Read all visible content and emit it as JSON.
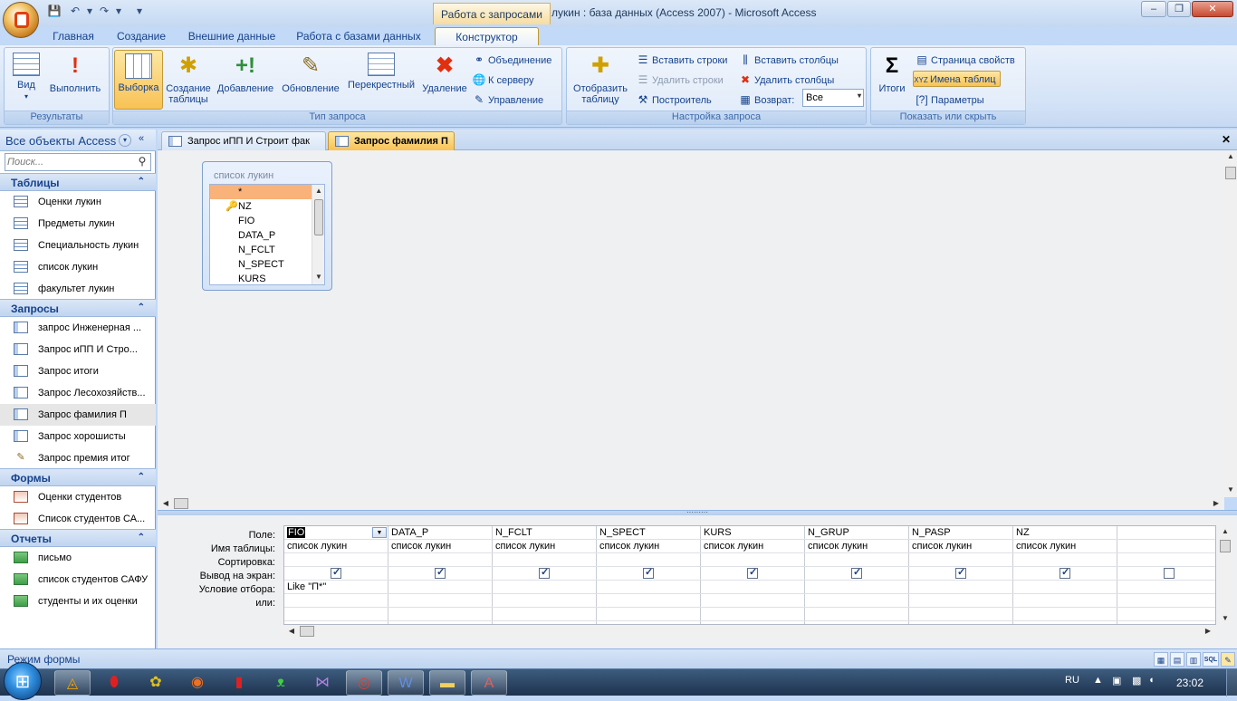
{
  "titlebar": {
    "context_tab": "Работа с запросами",
    "window_title": "лукин : база данных (Access 2007) - Microsoft Access",
    "minimize": "–",
    "maximize": "❐",
    "close": "✕"
  },
  "ribbon_tabs": [
    "Главная",
    "Создание",
    "Внешние данные",
    "Работа с базами данных",
    "Конструктор"
  ],
  "ribbon": {
    "results": {
      "name": "Результаты",
      "view": "Вид",
      "run": "Выполнить"
    },
    "query_type": {
      "name": "Тип запроса",
      "select": "Выборка",
      "make_table": "Создание таблицы",
      "append": "Добавление",
      "update": "Обновление",
      "crosstab": "Перекрестный",
      "delete": "Удаление",
      "union": "Объединение",
      "pass_through": "К серверу",
      "data_definition": "Управление"
    },
    "query_setup": {
      "name": "Настройка запроса",
      "show_table": "Отобразить таблицу",
      "insert_rows": "Вставить строки",
      "delete_rows": "Удалить строки",
      "builder": "Построитель",
      "insert_columns": "Вставить столбцы",
      "delete_columns": "Удалить столбцы",
      "return_label": "Возврат:",
      "return_value": "Все"
    },
    "show_hide": {
      "name": "Показать или скрыть",
      "totals": "Итоги",
      "property_sheet": "Страница свойств",
      "table_names": "Имена таблиц",
      "parameters": "Параметры"
    }
  },
  "nav": {
    "header": "Все объекты Access",
    "search_placeholder": "Поиск...",
    "sections": {
      "tables": {
        "title": "Таблицы",
        "items": [
          "Оценки лукин",
          "Предметы лукин",
          "Специальность лукин",
          "список лукин",
          "факультет лукин"
        ]
      },
      "queries": {
        "title": "Запросы",
        "items": [
          "запрос Инженерная ...",
          "Запрос иПП  И Стро...",
          "Запрос итоги",
          "Запрос Лесохозяйств...",
          "Запрос фамилия П",
          "Запрос хорошисты",
          "Запрос премия итог"
        ]
      },
      "forms": {
        "title": "Формы",
        "items": [
          "Оценки студентов",
          "Список студентов СА..."
        ]
      },
      "reports": {
        "title": "Отчеты",
        "items": [
          "письмо",
          "список студентов САФУ",
          "студенты и их оценки"
        ]
      }
    }
  },
  "doc_tabs": [
    "Запрос иПП  И Строит  фак",
    "Запрос фамилия П"
  ],
  "field_list": {
    "title": "список лукин",
    "fields": [
      "*",
      "NZ",
      "FIO",
      "DATA_P",
      "N_FCLT",
      "N_SPECT",
      "KURS"
    ]
  },
  "design_grid": {
    "row_labels": [
      "Поле:",
      "Имя таблицы:",
      "Сортировка:",
      "Вывод на экран:",
      "Условие отбора:",
      "или:"
    ],
    "columns": [
      {
        "field": "FIO",
        "table": "список лукин",
        "show": true,
        "criteria": "Like \"П*\""
      },
      {
        "field": "DATA_P",
        "table": "список лукин",
        "show": true,
        "criteria": ""
      },
      {
        "field": "N_FCLT",
        "table": "список лукин",
        "show": true,
        "criteria": ""
      },
      {
        "field": "N_SPECT",
        "table": "список лукин",
        "show": true,
        "criteria": ""
      },
      {
        "field": "KURS",
        "table": "список лукин",
        "show": true,
        "criteria": ""
      },
      {
        "field": "N_GRUP",
        "table": "список лукин",
        "show": true,
        "criteria": ""
      },
      {
        "field": "N_PASP",
        "table": "список лукин",
        "show": true,
        "criteria": ""
      },
      {
        "field": "NZ",
        "table": "список лукин",
        "show": true,
        "criteria": ""
      },
      {
        "field": "",
        "table": "",
        "show": false,
        "criteria": ""
      }
    ]
  },
  "status": {
    "text": "Режим формы",
    "sql": "SQL"
  },
  "taskbar": {
    "lang": "RU",
    "clock": "23:02"
  },
  "colors": {
    "ribbon_bg": "#d4e3f7",
    "accent": "#15428b",
    "selected": "#f8c255"
  }
}
